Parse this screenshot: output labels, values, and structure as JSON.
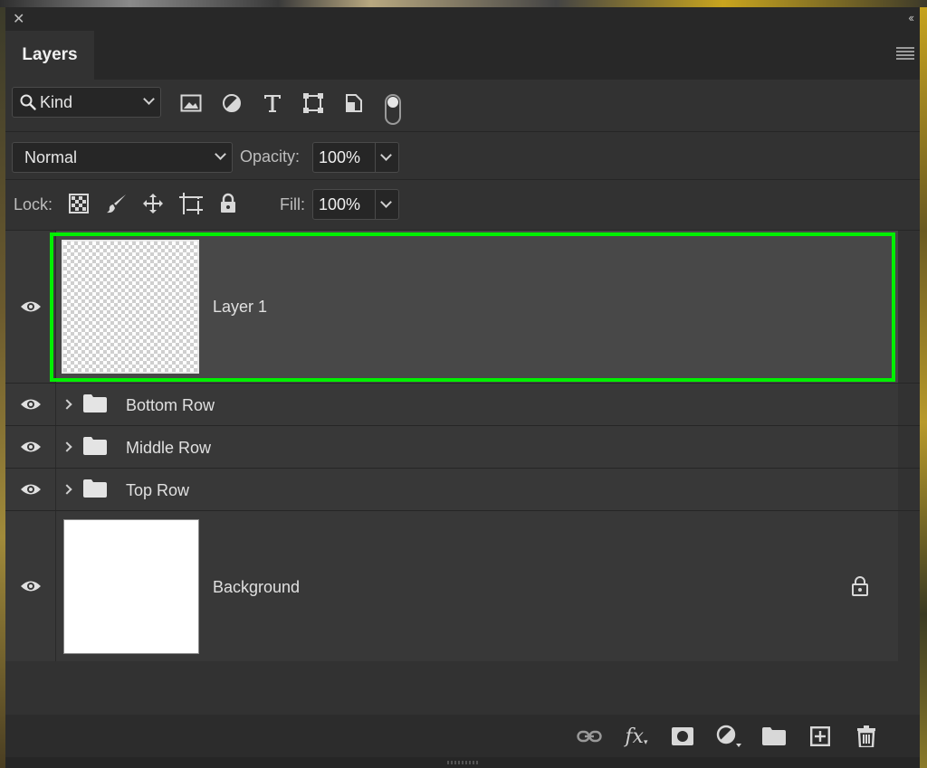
{
  "panel": {
    "tab_label": "Layers"
  },
  "filter": {
    "kind_label": "Kind",
    "icons": [
      "image-filter-icon",
      "adjustment-filter-icon",
      "type-filter-icon",
      "shape-filter-icon",
      "smart-object-filter-icon",
      "filter-toggle-switch"
    ]
  },
  "blend": {
    "mode": "Normal",
    "opacity_label": "Opacity:",
    "opacity_value": "100%"
  },
  "lock": {
    "label": "Lock:",
    "icons": [
      "lock-transparent-pixels-icon",
      "lock-image-pixels-icon",
      "lock-position-icon",
      "lock-artboard-icon",
      "lock-all-icon"
    ],
    "fill_label": "Fill:",
    "fill_value": "100%"
  },
  "layers": [
    {
      "name": "Layer 1",
      "type": "pixel",
      "selected": true,
      "visible": true
    },
    {
      "name": "Bottom Row",
      "type": "group",
      "visible": true
    },
    {
      "name": "Middle Row",
      "type": "group",
      "visible": true
    },
    {
      "name": "Top Row",
      "type": "group",
      "visible": true
    },
    {
      "name": "Background",
      "type": "background",
      "locked": true,
      "visible": true
    }
  ],
  "colors": {
    "panel_bg": "#323232",
    "layer_bg": "#383838",
    "selected_bg": "#484848",
    "selection_outline": "#00f000"
  },
  "footer": {
    "icons": [
      "link-layers-icon",
      "layer-style-fx-icon",
      "add-mask-icon",
      "new-adjustment-layer-icon",
      "new-group-icon",
      "new-layer-icon",
      "delete-layer-icon"
    ],
    "fx_label": "fx"
  }
}
